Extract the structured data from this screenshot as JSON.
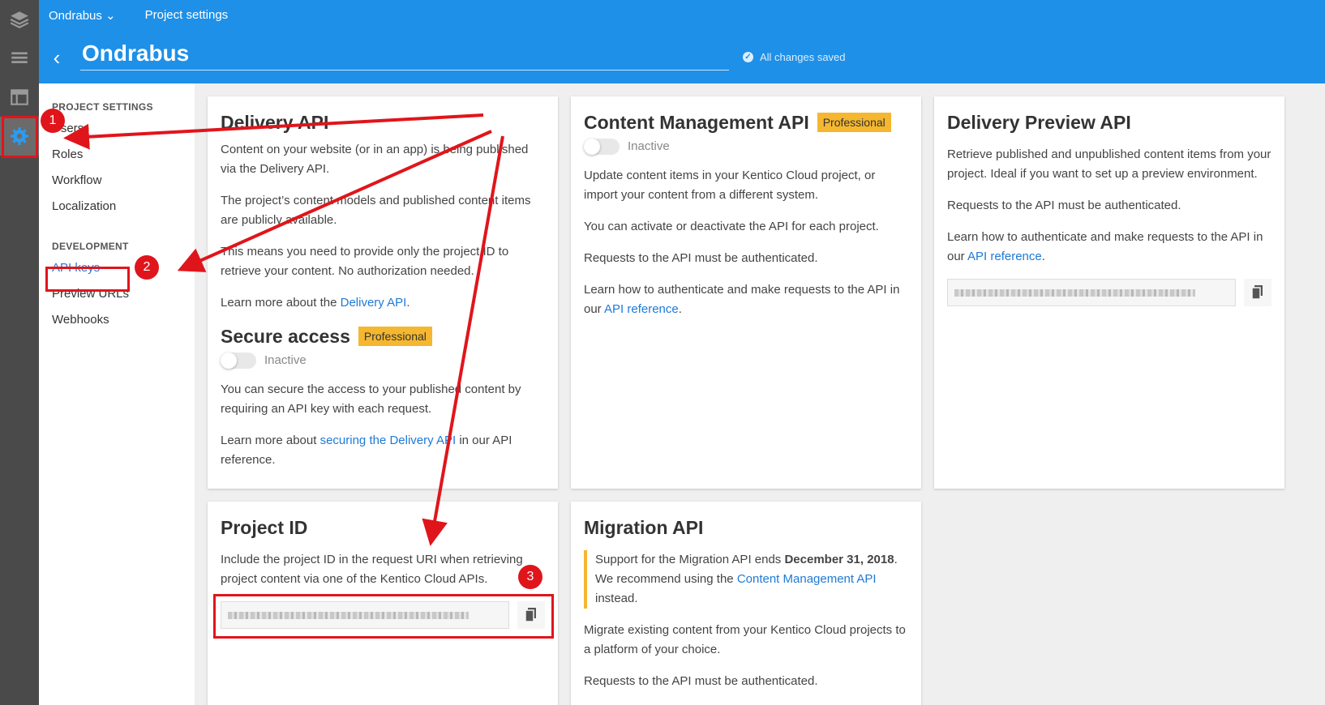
{
  "topbar": {
    "project_menu": "Ondrabus ⌄",
    "breadcrumb": "Project settings",
    "project_name": "Ondrabus",
    "saved_status": "All changes saved"
  },
  "rail": {
    "items": [
      {
        "icon": "layers-icon"
      },
      {
        "icon": "content-list-icon"
      },
      {
        "icon": "table-icon"
      },
      {
        "icon": "gear-icon"
      }
    ]
  },
  "sidebar": {
    "project_settings_header": "PROJECT SETTINGS",
    "project_items": [
      "Users",
      "Roles",
      "Workflow",
      "Localization"
    ],
    "development_header": "DEVELOPMENT",
    "development_items": [
      "API keys",
      "Preview URLs",
      "Webhooks"
    ]
  },
  "delivery_api": {
    "title": "Delivery API",
    "p1": "Content on your website (or in an app) is being published via the Delivery API.",
    "p2": "The project’s content models and published content items are publicly available.",
    "p3": "This means you need to provide only the project ID to retrieve your content. No authorization needed.",
    "p4_prefix": "Learn more about the ",
    "p4_link": "Delivery API",
    "p4_suffix": ".",
    "secure_title": "Secure access",
    "secure_badge": "Professional",
    "secure_status": "Inactive",
    "p5": "You can secure the access to your published content by requiring an API key with each request.",
    "p6_prefix": "Learn more about ",
    "p6_link": "securing the Delivery API",
    "p6_suffix": " in our API reference."
  },
  "cm_api": {
    "title": "Content Management API",
    "badge": "Professional",
    "status": "Inactive",
    "p1": "Update content items in your Kentico Cloud project, or import your content from a different system.",
    "p2": "You can activate or deactivate the API for each project.",
    "p3": "Requests to the API must be authenticated.",
    "p4_prefix": "Learn how to authenticate and make requests to the API in our ",
    "p4_link": "API reference",
    "p4_suffix": "."
  },
  "preview_api": {
    "title": "Delivery Preview API",
    "p1": "Retrieve published and unpublished content items from your project. Ideal if you want to set up a preview environment.",
    "p2": "Requests to the API must be authenticated.",
    "p3_prefix": "Learn how to authenticate and make requests to the API in our ",
    "p3_link": "API reference",
    "p3_suffix": "."
  },
  "project_id": {
    "title": "Project ID",
    "p1": "Include the project ID in the request URI when retrieving project content via one of the Kentico Cloud APIs."
  },
  "migration_api": {
    "title": "Migration API",
    "notice_prefix": "Support for the Migration API ends ",
    "notice_date": "December 31, 2018",
    "notice_mid": ". We recommend using the ",
    "notice_link": "Content Management API",
    "notice_suffix": " instead.",
    "p1": "Migrate existing content from your Kentico Cloud projects to a platform of your choice.",
    "p2": "Requests to the API must be authenticated."
  },
  "annotations": {
    "markers": [
      "1",
      "2",
      "3"
    ],
    "color": "#e0151b"
  }
}
